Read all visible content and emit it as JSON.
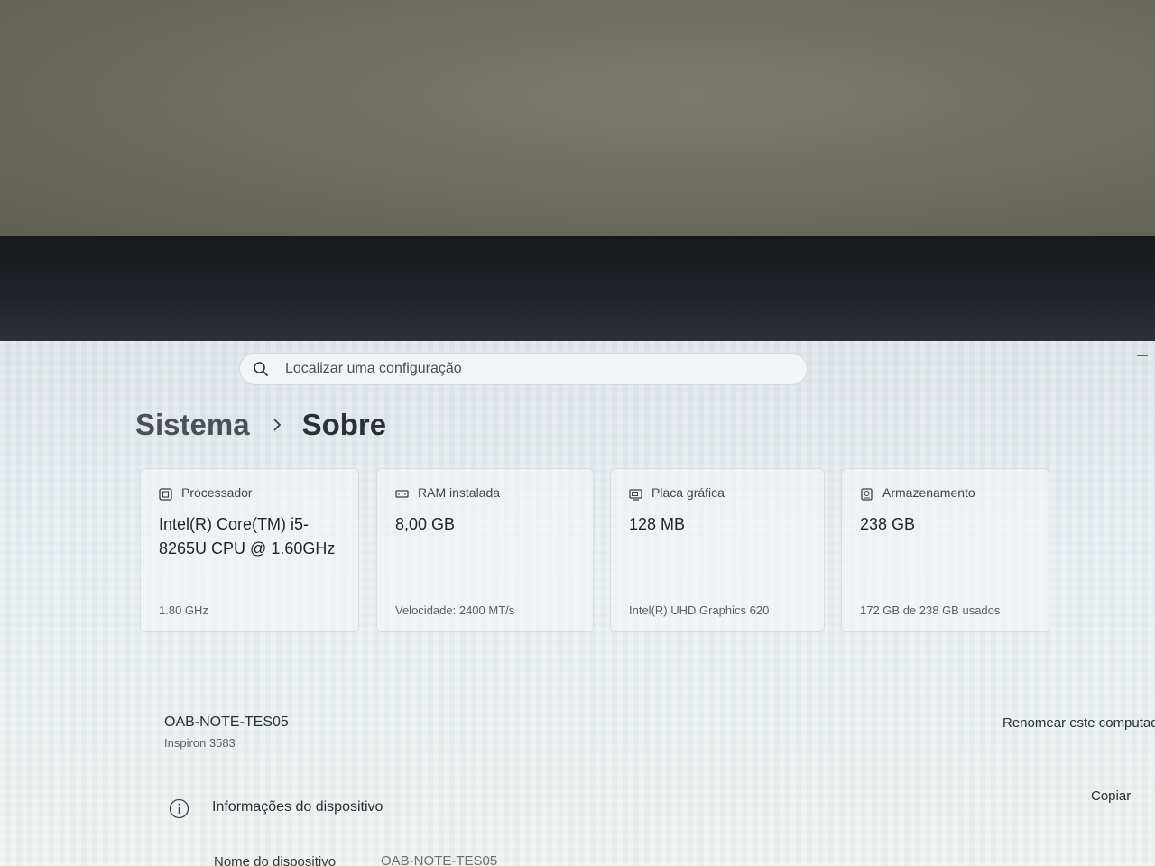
{
  "search": {
    "placeholder": "Localizar uma configuração"
  },
  "breadcrumb": {
    "parent": "Sistema",
    "current": "Sobre"
  },
  "specs": [
    {
      "icon": "processor-icon",
      "title": "Processador",
      "value": "Intel(R) Core(TM) i5-8265U CPU @ 1.60GHz",
      "sub": "1.80 GHz"
    },
    {
      "icon": "ram-icon",
      "title": "RAM instalada",
      "value": "8,00 GB",
      "sub": "Velocidade: 2400 MT/s"
    },
    {
      "icon": "graphics-card-icon",
      "title": "Placa gráfica",
      "value": "128 MB",
      "sub": "Intel(R) UHD Graphics 620"
    },
    {
      "icon": "storage-icon",
      "title": "Armazenamento",
      "value": "238 GB",
      "sub": "172 GB de 238 GB usados"
    }
  ],
  "device": {
    "name": "OAB-NOTE-TES05",
    "model": "Inspiron 3583",
    "rename_label": "Renomear este computador"
  },
  "device_info": {
    "section_label": "Informações do dispositivo",
    "copy_label": "Copiar",
    "properties": [
      {
        "label": "Nome do dispositivo",
        "value": "OAB-NOTE-TES05"
      }
    ]
  }
}
